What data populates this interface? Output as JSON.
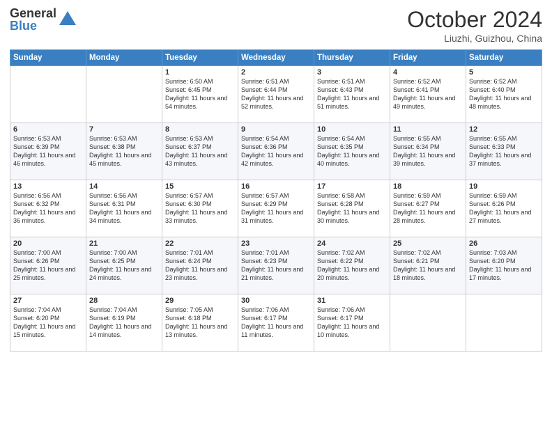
{
  "logo": {
    "general": "General",
    "blue": "Blue"
  },
  "title": "October 2024",
  "location": "Liuzhi, Guizhou, China",
  "days_of_week": [
    "Sunday",
    "Monday",
    "Tuesday",
    "Wednesday",
    "Thursday",
    "Friday",
    "Saturday"
  ],
  "weeks": [
    [
      {
        "day": "",
        "sunrise": "",
        "sunset": "",
        "daylight": ""
      },
      {
        "day": "",
        "sunrise": "",
        "sunset": "",
        "daylight": ""
      },
      {
        "day": "1",
        "sunrise": "Sunrise: 6:50 AM",
        "sunset": "Sunset: 6:45 PM",
        "daylight": "Daylight: 11 hours and 54 minutes."
      },
      {
        "day": "2",
        "sunrise": "Sunrise: 6:51 AM",
        "sunset": "Sunset: 6:44 PM",
        "daylight": "Daylight: 11 hours and 52 minutes."
      },
      {
        "day": "3",
        "sunrise": "Sunrise: 6:51 AM",
        "sunset": "Sunset: 6:43 PM",
        "daylight": "Daylight: 11 hours and 51 minutes."
      },
      {
        "day": "4",
        "sunrise": "Sunrise: 6:52 AM",
        "sunset": "Sunset: 6:41 PM",
        "daylight": "Daylight: 11 hours and 49 minutes."
      },
      {
        "day": "5",
        "sunrise": "Sunrise: 6:52 AM",
        "sunset": "Sunset: 6:40 PM",
        "daylight": "Daylight: 11 hours and 48 minutes."
      }
    ],
    [
      {
        "day": "6",
        "sunrise": "Sunrise: 6:53 AM",
        "sunset": "Sunset: 6:39 PM",
        "daylight": "Daylight: 11 hours and 46 minutes."
      },
      {
        "day": "7",
        "sunrise": "Sunrise: 6:53 AM",
        "sunset": "Sunset: 6:38 PM",
        "daylight": "Daylight: 11 hours and 45 minutes."
      },
      {
        "day": "8",
        "sunrise": "Sunrise: 6:53 AM",
        "sunset": "Sunset: 6:37 PM",
        "daylight": "Daylight: 11 hours and 43 minutes."
      },
      {
        "day": "9",
        "sunrise": "Sunrise: 6:54 AM",
        "sunset": "Sunset: 6:36 PM",
        "daylight": "Daylight: 11 hours and 42 minutes."
      },
      {
        "day": "10",
        "sunrise": "Sunrise: 6:54 AM",
        "sunset": "Sunset: 6:35 PM",
        "daylight": "Daylight: 11 hours and 40 minutes."
      },
      {
        "day": "11",
        "sunrise": "Sunrise: 6:55 AM",
        "sunset": "Sunset: 6:34 PM",
        "daylight": "Daylight: 11 hours and 39 minutes."
      },
      {
        "day": "12",
        "sunrise": "Sunrise: 6:55 AM",
        "sunset": "Sunset: 6:33 PM",
        "daylight": "Daylight: 11 hours and 37 minutes."
      }
    ],
    [
      {
        "day": "13",
        "sunrise": "Sunrise: 6:56 AM",
        "sunset": "Sunset: 6:32 PM",
        "daylight": "Daylight: 11 hours and 36 minutes."
      },
      {
        "day": "14",
        "sunrise": "Sunrise: 6:56 AM",
        "sunset": "Sunset: 6:31 PM",
        "daylight": "Daylight: 11 hours and 34 minutes."
      },
      {
        "day": "15",
        "sunrise": "Sunrise: 6:57 AM",
        "sunset": "Sunset: 6:30 PM",
        "daylight": "Daylight: 11 hours and 33 minutes."
      },
      {
        "day": "16",
        "sunrise": "Sunrise: 6:57 AM",
        "sunset": "Sunset: 6:29 PM",
        "daylight": "Daylight: 11 hours and 31 minutes."
      },
      {
        "day": "17",
        "sunrise": "Sunrise: 6:58 AM",
        "sunset": "Sunset: 6:28 PM",
        "daylight": "Daylight: 11 hours and 30 minutes."
      },
      {
        "day": "18",
        "sunrise": "Sunrise: 6:59 AM",
        "sunset": "Sunset: 6:27 PM",
        "daylight": "Daylight: 11 hours and 28 minutes."
      },
      {
        "day": "19",
        "sunrise": "Sunrise: 6:59 AM",
        "sunset": "Sunset: 6:26 PM",
        "daylight": "Daylight: 11 hours and 27 minutes."
      }
    ],
    [
      {
        "day": "20",
        "sunrise": "Sunrise: 7:00 AM",
        "sunset": "Sunset: 6:26 PM",
        "daylight": "Daylight: 11 hours and 25 minutes."
      },
      {
        "day": "21",
        "sunrise": "Sunrise: 7:00 AM",
        "sunset": "Sunset: 6:25 PM",
        "daylight": "Daylight: 11 hours and 24 minutes."
      },
      {
        "day": "22",
        "sunrise": "Sunrise: 7:01 AM",
        "sunset": "Sunset: 6:24 PM",
        "daylight": "Daylight: 11 hours and 23 minutes."
      },
      {
        "day": "23",
        "sunrise": "Sunrise: 7:01 AM",
        "sunset": "Sunset: 6:23 PM",
        "daylight": "Daylight: 11 hours and 21 minutes."
      },
      {
        "day": "24",
        "sunrise": "Sunrise: 7:02 AM",
        "sunset": "Sunset: 6:22 PM",
        "daylight": "Daylight: 11 hours and 20 minutes."
      },
      {
        "day": "25",
        "sunrise": "Sunrise: 7:02 AM",
        "sunset": "Sunset: 6:21 PM",
        "daylight": "Daylight: 11 hours and 18 minutes."
      },
      {
        "day": "26",
        "sunrise": "Sunrise: 7:03 AM",
        "sunset": "Sunset: 6:20 PM",
        "daylight": "Daylight: 11 hours and 17 minutes."
      }
    ],
    [
      {
        "day": "27",
        "sunrise": "Sunrise: 7:04 AM",
        "sunset": "Sunset: 6:20 PM",
        "daylight": "Daylight: 11 hours and 15 minutes."
      },
      {
        "day": "28",
        "sunrise": "Sunrise: 7:04 AM",
        "sunset": "Sunset: 6:19 PM",
        "daylight": "Daylight: 11 hours and 14 minutes."
      },
      {
        "day": "29",
        "sunrise": "Sunrise: 7:05 AM",
        "sunset": "Sunset: 6:18 PM",
        "daylight": "Daylight: 11 hours and 13 minutes."
      },
      {
        "day": "30",
        "sunrise": "Sunrise: 7:06 AM",
        "sunset": "Sunset: 6:17 PM",
        "daylight": "Daylight: 11 hours and 11 minutes."
      },
      {
        "day": "31",
        "sunrise": "Sunrise: 7:06 AM",
        "sunset": "Sunset: 6:17 PM",
        "daylight": "Daylight: 11 hours and 10 minutes."
      },
      {
        "day": "",
        "sunrise": "",
        "sunset": "",
        "daylight": ""
      },
      {
        "day": "",
        "sunrise": "",
        "sunset": "",
        "daylight": ""
      }
    ]
  ]
}
